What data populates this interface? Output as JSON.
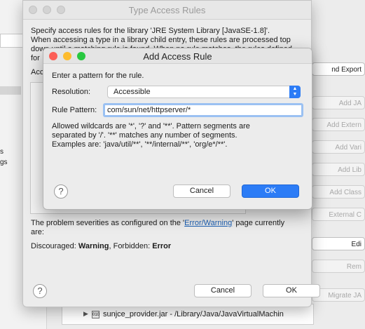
{
  "background": {
    "left_texts": [
      "s",
      "gs"
    ],
    "right_buttons": [
      {
        "label": "nd Export",
        "enabled": true
      },
      {
        "label": "Add JA",
        "enabled": false
      },
      {
        "label": "Add Extern",
        "enabled": false
      },
      {
        "label": "Add Vari",
        "enabled": false
      },
      {
        "label": "Add Lib",
        "enabled": false
      },
      {
        "label": "Add Class",
        "enabled": false
      },
      {
        "label": "External C",
        "enabled": false
      },
      {
        "label": "Edi",
        "enabled": true
      },
      {
        "label": "Rem",
        "enabled": false
      },
      {
        "label": "Migrate JA",
        "enabled": false
      }
    ],
    "tree_row": "sunjce_provider.jar - /Library/Java/JavaVirtualMachin",
    "tree_row_icon": "jar-icon"
  },
  "type_access_rules": {
    "title": "Type Access Rules",
    "description_lines": [
      "Specify access rules for the library 'JRE System Library [JavaSE-1.8]'.",
      "When accessing a type in a library child entry, these rules are processed top",
      "down until a matching rule is found. When no rule matches, the rules defined",
      "for"
    ],
    "access_rules_label": "Acc",
    "severity_text_before": "The problem severities as configured on the '",
    "severity_link": "Error/Warning",
    "severity_text_after": "' page currently",
    "severity_text_line2": "are:",
    "discouraged_label": "Discouraged:",
    "discouraged_value": "Warning",
    "forbidden_label": ", Forbidden:",
    "forbidden_value": "Error",
    "cancel_label": "Cancel",
    "ok_label": "OK",
    "help_icon": "?"
  },
  "add_access_rule": {
    "title": "Add Access Rule",
    "prompt": "Enter a pattern for the rule.",
    "resolution_label": "Resolution:",
    "resolution_value": "Accessible",
    "resolution_arrow": "▲▼",
    "pattern_label": "Rule Pattern:",
    "pattern_value": "com/sun/net/httpserver/*",
    "hint_lines": [
      "Allowed wildcards are '*', '?' and '**'. Pattern segments are",
      "separated by '/'. '**' matches any number of segments.",
      "Examples are: 'java/util/**', '**/internal/**', 'org/e*/**'."
    ],
    "cancel_label": "Cancel",
    "ok_label": "OK",
    "help_icon": "?"
  },
  "colors": {
    "accent": "#2c7cf6",
    "link": "#1a5fb4",
    "close_light": "#fc5f57",
    "minimize_light": "#fdbc2e",
    "zoom_light": "#28c840"
  }
}
